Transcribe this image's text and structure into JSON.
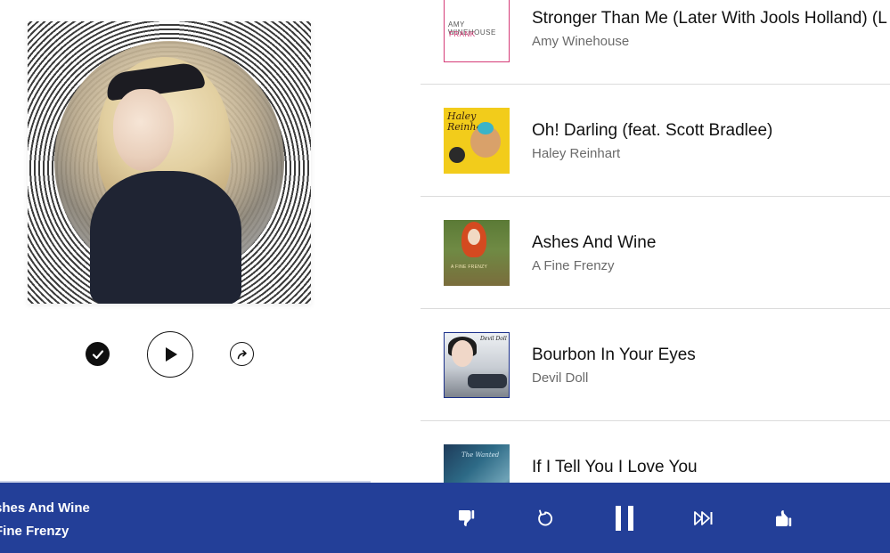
{
  "album_art": {
    "label": "Album art"
  },
  "actions": {
    "check_icon": "checkmark-icon",
    "play_icon": "play-icon",
    "share_icon": "share-icon"
  },
  "tracks": [
    {
      "title": "Stronger Than Me (Later With Jools Holland) (L",
      "artist": "Amy Winehouse",
      "thumb_line1": "AMY",
      "thumb_line2": "WINEHOUSE",
      "thumb_line3": "FRANK"
    },
    {
      "title": "Oh! Darling (feat. Scott Bradlee)",
      "artist": "Haley Reinhart",
      "thumb_line1": "Haley",
      "thumb_line2": "Reinhart"
    },
    {
      "title": "Ashes And Wine",
      "artist": "A Fine Frenzy",
      "thumb_line1": "A FINE FRENZY"
    },
    {
      "title": "Bourbon In Your Eyes",
      "artist": "Devil Doll",
      "thumb_line1": "Devil Doll"
    },
    {
      "title": "If I Tell You I Love You",
      "artist": "",
      "thumb_line1": "The Wanted"
    }
  ],
  "now_playing": {
    "title": "shes And Wine",
    "artist": "Fine Frenzy"
  },
  "controls": {
    "thumbs_down": "thumbs-down-icon",
    "replay": "replay-icon",
    "pause": "pause-icon",
    "skip": "skip-next-icon",
    "thumbs_up": "thumbs-up-icon"
  },
  "colors": {
    "bar_background": "#233f98",
    "bar_text": "#ffffff",
    "divider": "#dcdcdc",
    "artist_text": "#6b6b6b"
  }
}
